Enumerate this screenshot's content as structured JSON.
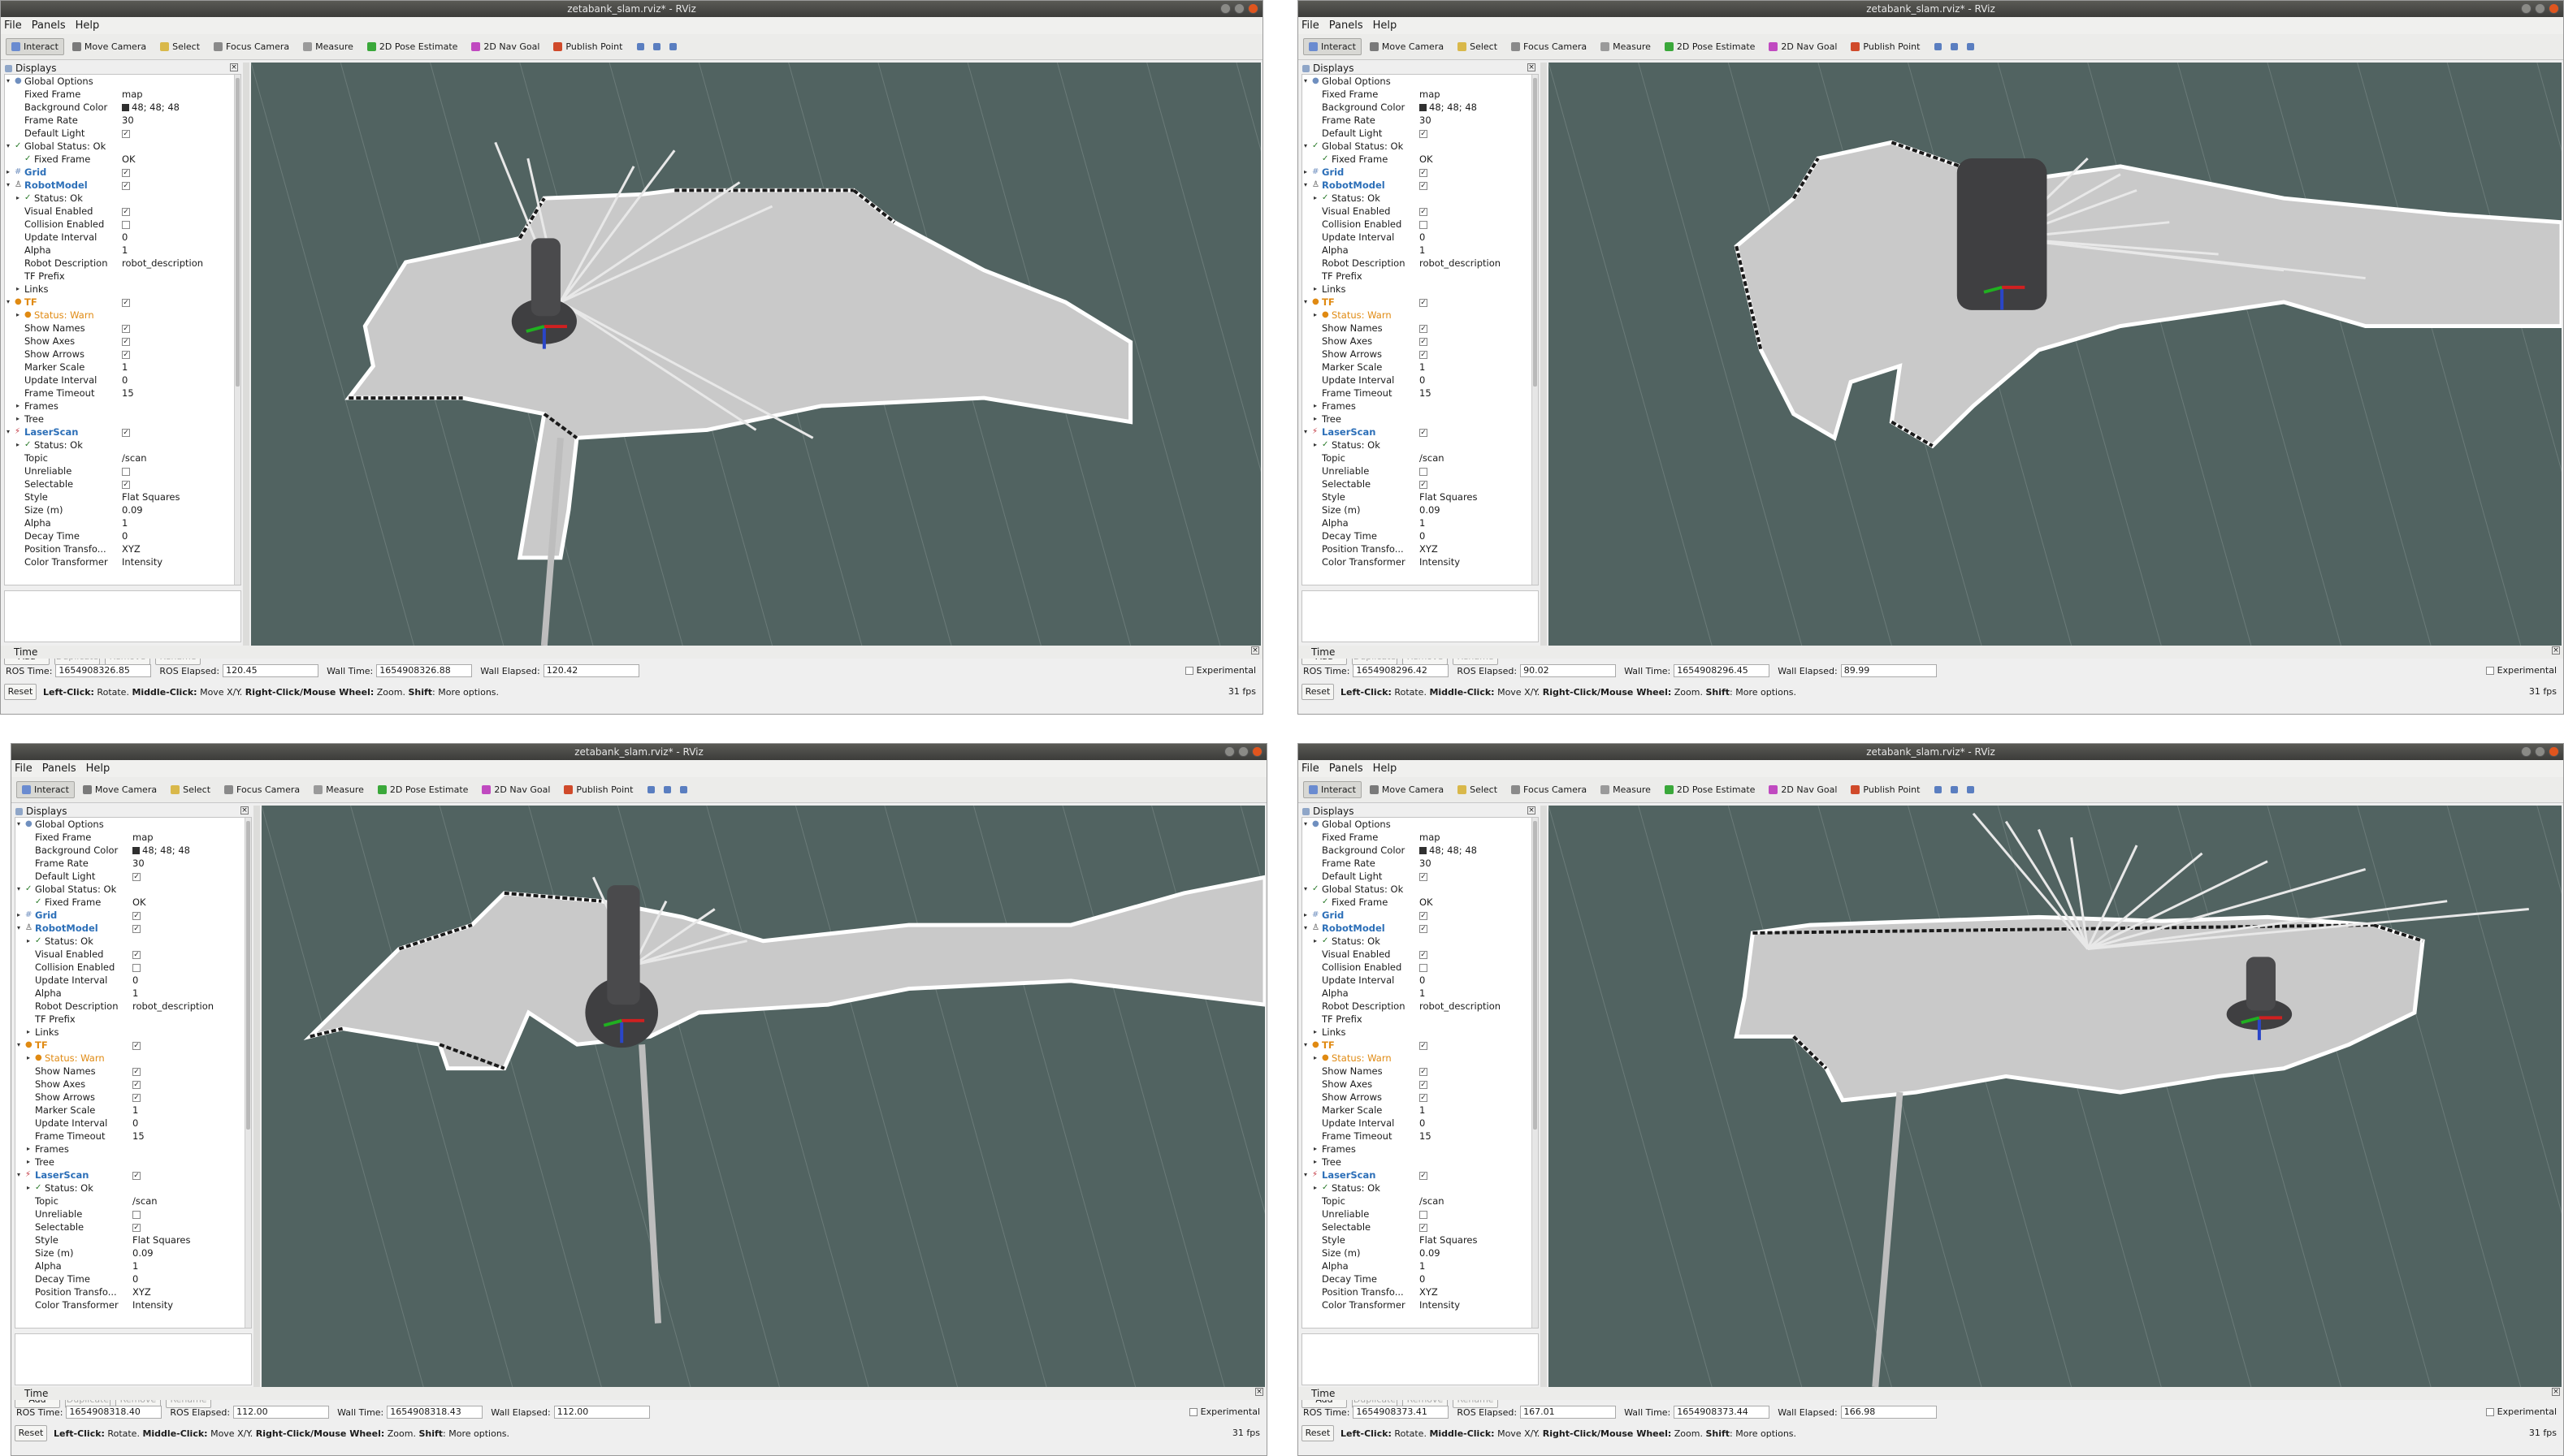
{
  "app": {
    "menu": [
      "File",
      "Panels",
      "Help"
    ],
    "toolbar": [
      {
        "label": "Interact",
        "icon": "interact-icon",
        "color": "#6a8bd0"
      },
      {
        "label": "Move Camera",
        "icon": "move-camera-icon",
        "color": "#7a7a7a"
      },
      {
        "label": "Select",
        "icon": "select-icon",
        "color": "#d9b84a"
      },
      {
        "label": "Focus Camera",
        "icon": "focus-camera-icon",
        "color": "#8a8a8a"
      },
      {
        "label": "Measure",
        "icon": "measure-icon",
        "color": "#9a9a9a"
      },
      {
        "label": "2D Pose Estimate",
        "icon": "pose-estimate-icon",
        "color": "#3aa83a"
      },
      {
        "label": "2D Nav Goal",
        "icon": "nav-goal-icon",
        "color": "#c04ac0"
      },
      {
        "label": "Publish Point",
        "icon": "publish-point-icon",
        "color": "#d04a2a"
      }
    ],
    "displays_title": "Displays",
    "time_title": "Time",
    "buttons": {
      "add": "Add",
      "duplicate": "Duplicate",
      "remove": "Remove",
      "rename": "Rename"
    },
    "time_labels": {
      "ros_time": "ROS Time:",
      "ros_elapsed": "ROS Elapsed:",
      "wall_time": "Wall Time:",
      "wall_elapsed": "Wall Elapsed:"
    },
    "experimental": "Experimental",
    "reset": "Reset",
    "hint_bold1": "Left-Click:",
    "hint_text1": " Rotate. ",
    "hint_bold2": "Middle-Click:",
    "hint_text2": " Move X/Y. ",
    "hint_bold3": "Right-Click/Mouse Wheel:",
    "hint_text3": " Zoom. ",
    "hint_bold4": "Shift",
    "hint_text4": ": More options.",
    "colors": {
      "viewport_bg": "#516361",
      "map_free": "#c9c9c9",
      "map_wall": "#ffffff",
      "robot": "#3f3f41",
      "accent_blue": "#2c6fb8",
      "accent_warn": "#e08a12"
    }
  },
  "tree_rows": [
    {
      "label": "Global Options",
      "value": "",
      "indent": 1,
      "icon": "globe-icon",
      "expand": "open",
      "style": ""
    },
    {
      "label": "Fixed Frame",
      "value": "map",
      "indent": 2,
      "style": ""
    },
    {
      "label": "Background Color",
      "value": "48; 48; 48",
      "indent": 2,
      "swatch": true,
      "style": ""
    },
    {
      "label": "Frame Rate",
      "value": "30",
      "indent": 2,
      "style": ""
    },
    {
      "label": "Default Light",
      "value": "",
      "indent": 2,
      "check": true,
      "style": ""
    },
    {
      "label": "Global Status: Ok",
      "value": "",
      "indent": 1,
      "icon": "check-icon",
      "expand": "open",
      "style": ""
    },
    {
      "label": "Fixed Frame",
      "value": "OK",
      "indent": 2,
      "icon": "check-icon",
      "style": ""
    },
    {
      "label": "Grid",
      "value": "",
      "indent": 1,
      "icon": "grid-icon",
      "expand": "closed",
      "check": true,
      "style": "blue"
    },
    {
      "label": "RobotModel",
      "value": "",
      "indent": 1,
      "icon": "robot-icon",
      "expand": "open",
      "check": true,
      "style": "blue"
    },
    {
      "label": "Status: Ok",
      "value": "",
      "indent": 2,
      "icon": "check-icon",
      "expand": "closed",
      "style": ""
    },
    {
      "label": "Visual Enabled",
      "value": "",
      "indent": 2,
      "check": true,
      "style": ""
    },
    {
      "label": "Collision Enabled",
      "value": "",
      "indent": 2,
      "check": false,
      "style": ""
    },
    {
      "label": "Update Interval",
      "value": "0",
      "indent": 2,
      "style": ""
    },
    {
      "label": "Alpha",
      "value": "1",
      "indent": 2,
      "style": ""
    },
    {
      "label": "Robot Description",
      "value": "robot_description",
      "indent": 2,
      "style": ""
    },
    {
      "label": "TF Prefix",
      "value": "",
      "indent": 2,
      "style": ""
    },
    {
      "label": "Links",
      "value": "",
      "indent": 2,
      "expand": "closed",
      "style": ""
    },
    {
      "label": "TF",
      "value": "",
      "indent": 1,
      "icon": "warning-icon",
      "expand": "open",
      "check": true,
      "style": "orange"
    },
    {
      "label": "Status: Warn",
      "value": "",
      "indent": 2,
      "icon": "warning-icon",
      "expand": "closed",
      "style": "warn"
    },
    {
      "label": "Show Names",
      "value": "",
      "indent": 2,
      "check": true,
      "style": ""
    },
    {
      "label": "Show Axes",
      "value": "",
      "indent": 2,
      "check": true,
      "style": ""
    },
    {
      "label": "Show Arrows",
      "value": "",
      "indent": 2,
      "check": true,
      "style": ""
    },
    {
      "label": "Marker Scale",
      "value": "1",
      "indent": 2,
      "style": ""
    },
    {
      "label": "Update Interval",
      "value": "0",
      "indent": 2,
      "style": ""
    },
    {
      "label": "Frame Timeout",
      "value": "15",
      "indent": 2,
      "style": ""
    },
    {
      "label": "Frames",
      "value": "",
      "indent": 2,
      "expand": "closed",
      "style": ""
    },
    {
      "label": "Tree",
      "value": "",
      "indent": 2,
      "expand": "closed",
      "style": ""
    },
    {
      "label": "LaserScan",
      "value": "",
      "indent": 1,
      "icon": "laser-icon",
      "expand": "open",
      "check": true,
      "style": "blue"
    },
    {
      "label": "Status: Ok",
      "value": "",
      "indent": 2,
      "icon": "check-icon",
      "expand": "closed",
      "style": ""
    },
    {
      "label": "Topic",
      "value": "/scan",
      "indent": 2,
      "style": ""
    },
    {
      "label": "Unreliable",
      "value": "",
      "indent": 2,
      "check": false,
      "style": ""
    },
    {
      "label": "Selectable",
      "value": "",
      "indent": 2,
      "check": true,
      "style": ""
    },
    {
      "label": "Style",
      "value": "Flat Squares",
      "indent": 2,
      "style": ""
    },
    {
      "label": "Size (m)",
      "value": "0.09",
      "indent": 2,
      "style": ""
    },
    {
      "label": "Alpha",
      "value": "1",
      "indent": 2,
      "style": ""
    },
    {
      "label": "Decay Time",
      "value": "0",
      "indent": 2,
      "style": ""
    },
    {
      "label": "Position Transfo...",
      "value": "XYZ",
      "indent": 2,
      "style": ""
    },
    {
      "label": "Color Transformer",
      "value": "Intensity",
      "indent": 2,
      "style": ""
    }
  ],
  "windows": [
    {
      "title": "zetabank_slam.rviz* - RViz",
      "ros_time": "1654908326.85",
      "ros_elapsed": "120.45",
      "wall_time": "1654908326.88",
      "wall_elapsed": "120.42",
      "fps": "31 fps"
    },
    {
      "title": "zetabank_slam.rviz* - RViz",
      "ros_time": "1654908296.42",
      "ros_elapsed": "90.02",
      "wall_time": "1654908296.45",
      "wall_elapsed": "89.99",
      "fps": "31 fps"
    },
    {
      "title": "zetabank_slam.rviz* - RViz",
      "ros_time": "1654908318.40",
      "ros_elapsed": "112.00",
      "wall_time": "1654908318.43",
      "wall_elapsed": "112.00",
      "fps": "31 fps"
    },
    {
      "title": "zetabank_slam.rviz* - RViz",
      "ros_time": "1654908373.41",
      "ros_elapsed": "167.01",
      "wall_time": "1654908373.44",
      "wall_elapsed": "166.98",
      "fps": "31 fps"
    }
  ]
}
